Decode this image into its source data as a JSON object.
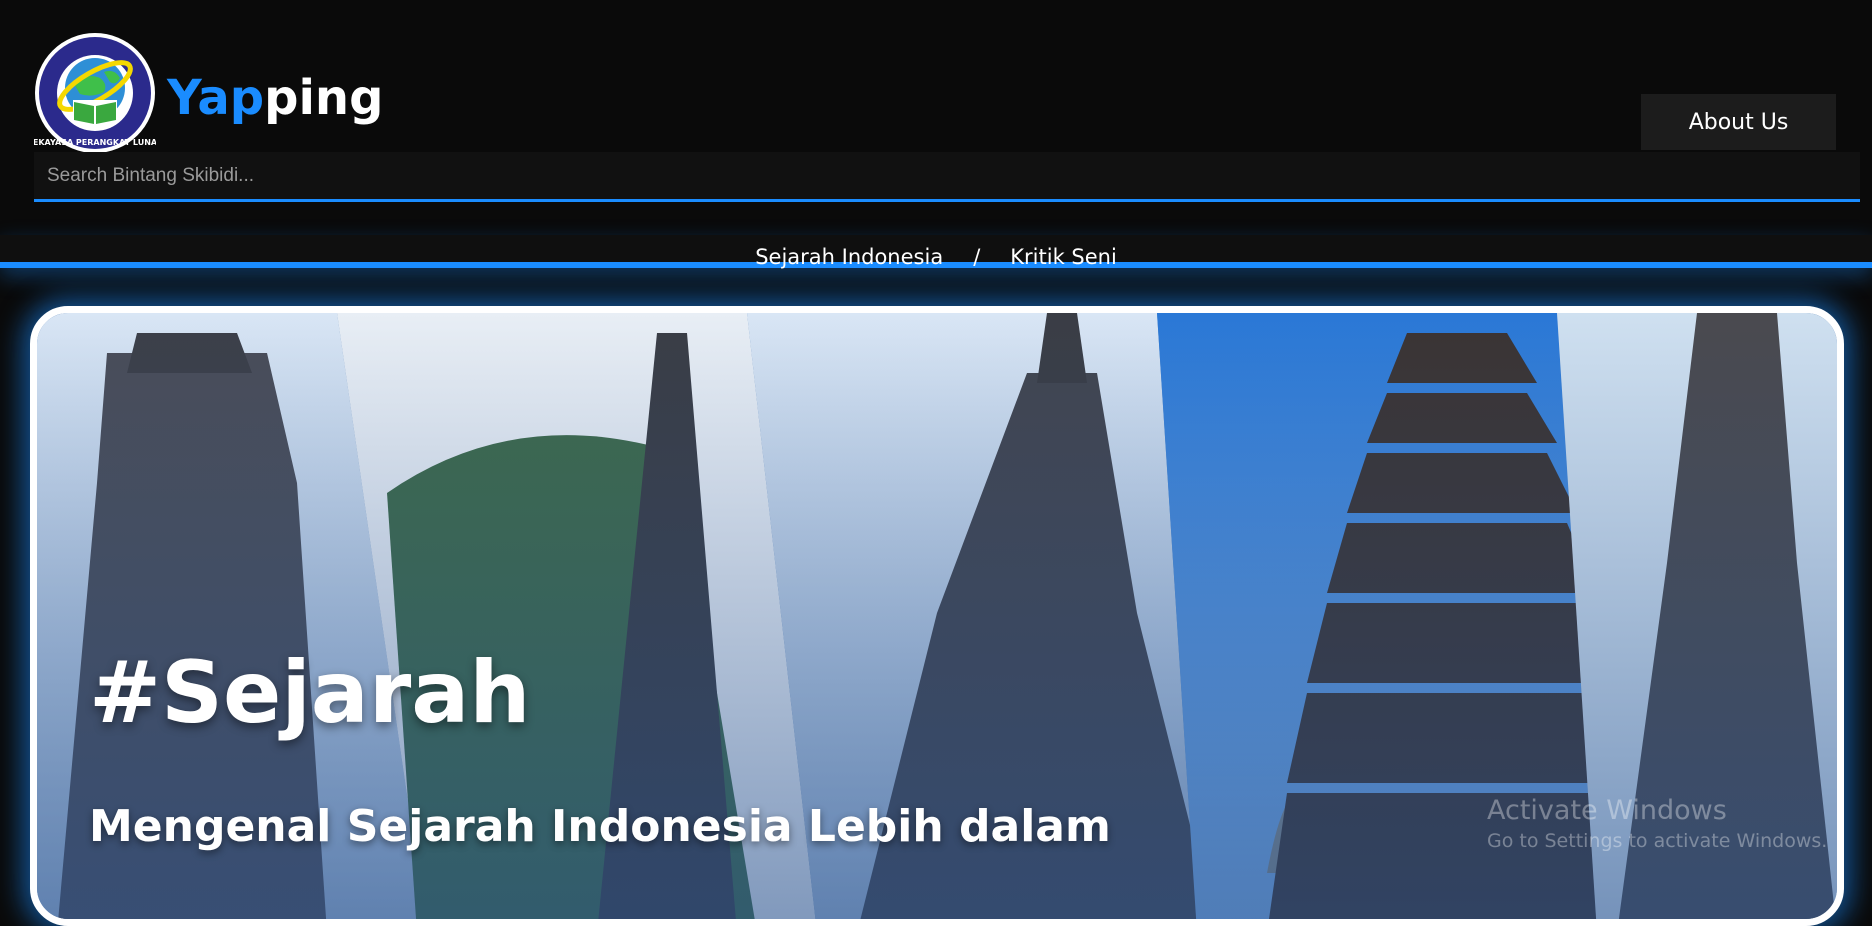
{
  "brand": {
    "part1": "Yap",
    "part2": "ping"
  },
  "logo": {
    "ring_text": "REKAYASA PERANGKAT LUNAK",
    "icon": "globe-book-emblem"
  },
  "header": {
    "about_label": "About Us"
  },
  "search": {
    "placeholder": "Search Bintang Skibidi...",
    "value": ""
  },
  "nav": {
    "items": [
      {
        "label": "Sejarah Indonesia"
      },
      {
        "label": "Kritik Seni"
      }
    ],
    "separator": "/"
  },
  "hero": {
    "tag": "#Sejarah",
    "subtitle": "Mengenal Sejarah Indonesia Lebih dalam"
  },
  "watermark": {
    "title": "Activate Windows",
    "subtitle": "Go to Settings to activate Windows."
  },
  "colors": {
    "accent": "#1a8cff",
    "background": "#0a0a0a",
    "panel": "#1c1c1c"
  }
}
